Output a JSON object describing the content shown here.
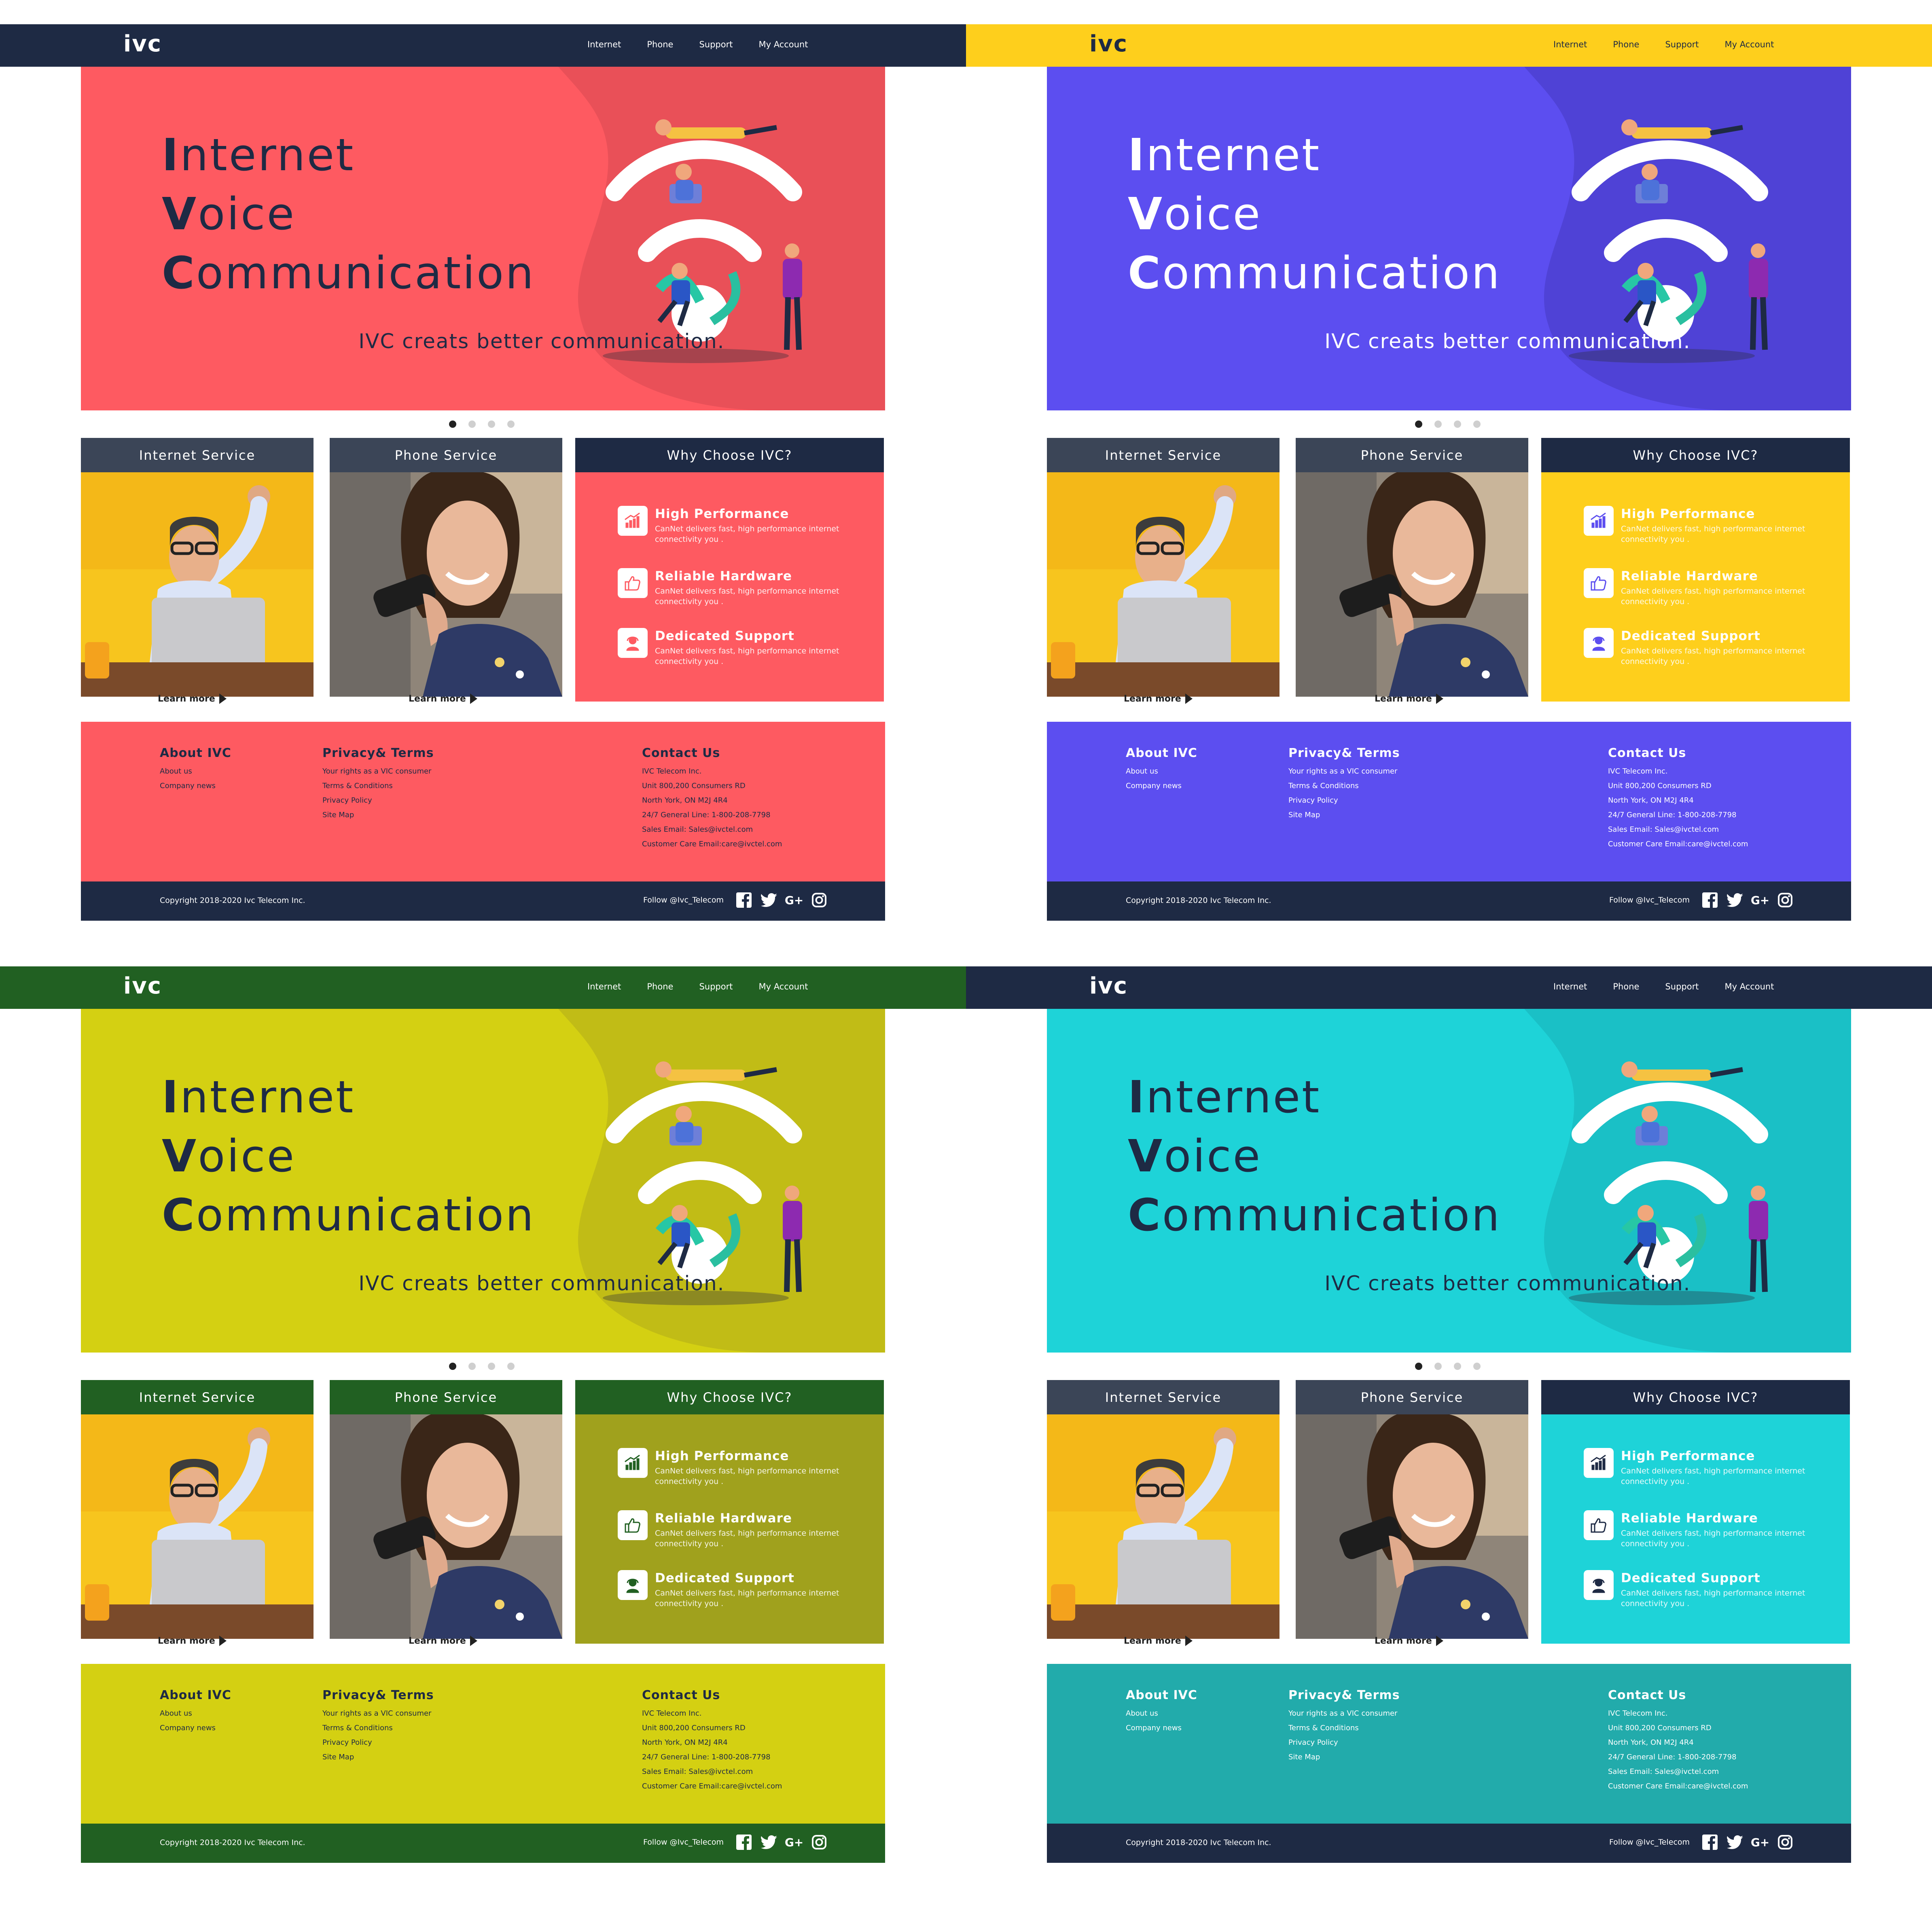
{
  "site": {
    "logo": "ivc",
    "nav": [
      "Internet",
      "Phone",
      "Support",
      "My Account"
    ],
    "hero": {
      "line1_cap": "I",
      "line1_rest": "nternet",
      "line2_cap": "V",
      "line2_rest": "oice",
      "line3_cap": "C",
      "line3_rest": "ommunication",
      "subtitle": "IVC creats better communication."
    },
    "cards": {
      "internet": "Internet Service",
      "phone": "Phone Service",
      "learn_more": "Learn more",
      "why": "Why Choose IVC?"
    },
    "features": [
      {
        "title": "High Performance",
        "desc": "CanNet delivers fast, high performance internet connectivity you .",
        "icon": "chart-icon"
      },
      {
        "title": "Reliable Hardware",
        "desc": "CanNet delivers fast, high performance internet connectivity you .",
        "icon": "thumbs-up-icon"
      },
      {
        "title": "Dedicated Support",
        "desc": "CanNet delivers fast, high performance internet connectivity you .",
        "icon": "support-agent-icon"
      }
    ],
    "footer": {
      "about_title": "About IVC",
      "about_links": [
        "About us",
        "Company news"
      ],
      "privacy_title": "Privacy& Terms",
      "privacy_links": [
        "Your rights as a VIC consumer",
        "Terms & Conditions",
        "Privacy Policy",
        "Site Map"
      ],
      "contact_title": "Contact Us",
      "contact_lines": [
        "IVC Telecom Inc.",
        "Unit 800,200 Consumers RD",
        "North York, ON M2J 4R4",
        "24/7 General Line: 1-800-208-7798",
        "Sales Email: Sales@ivctel.com",
        "Customer Care Email:care@ivctel.com"
      ],
      "copyright": "Copyright 2018-2020 Ivc Telecom Inc.",
      "follow": "Follow @Ivc_Telecom",
      "social_icons": [
        "facebook-icon",
        "twitter-icon",
        "google-plus-icon",
        "instagram-icon"
      ]
    }
  },
  "variants": [
    {
      "name": "coral",
      "nav_bg": "#1e2a44",
      "nav_text": "#ffffff",
      "logo_color": "#ffffff",
      "hero_bg": "#fe5a61",
      "wave": "#e95058",
      "text": "#1e2a44",
      "card_head": "#3b4557",
      "why_bg": "#fe5a61",
      "why_head": "#1e2a44",
      "icon_fg": "#fe5a61",
      "footer_bg": "#fe5a61",
      "footer_link": "#1e2a44",
      "bottom_bg": "#1e2a44"
    },
    {
      "name": "violet",
      "nav_bg": "#fecf1c",
      "nav_text": "#1e2a44",
      "logo_color": "#1e2a44",
      "hero_bg": "#5c4ef0",
      "wave": "#4f42d6",
      "text": "#ffffff",
      "card_head": "#3b4557",
      "why_bg": "#fecf1c",
      "why_head": "#1e2a44",
      "icon_fg": "#5c4ef0",
      "footer_bg": "#5c4ef0",
      "footer_link": "#ffffff",
      "bottom_bg": "#1e2a44"
    },
    {
      "name": "lime",
      "nav_bg": "#216022",
      "nav_text": "#ffffff",
      "logo_color": "#ffffff",
      "hero_bg": "#d4d012",
      "wave": "#c1bc16",
      "text": "#1e2a44",
      "card_head": "#216022",
      "why_bg": "#a0a11d",
      "why_head": "#216022",
      "icon_fg": "#216022",
      "footer_bg": "#d4d012",
      "footer_link": "#1e2a44",
      "bottom_bg": "#216022"
    },
    {
      "name": "cyan",
      "nav_bg": "#1e2a44",
      "nav_text": "#ffffff",
      "logo_color": "#ffffff",
      "hero_bg": "#1ed3d8",
      "wave": "#1ac0c6",
      "text": "#1e2a44",
      "card_head": "#3b4557",
      "why_bg": "#1ed3d8",
      "why_head": "#1e2a44",
      "icon_fg": "#1e2a44",
      "footer_bg": "#22abab",
      "footer_link": "#ffffff",
      "bottom_bg": "#1e2a44"
    }
  ]
}
